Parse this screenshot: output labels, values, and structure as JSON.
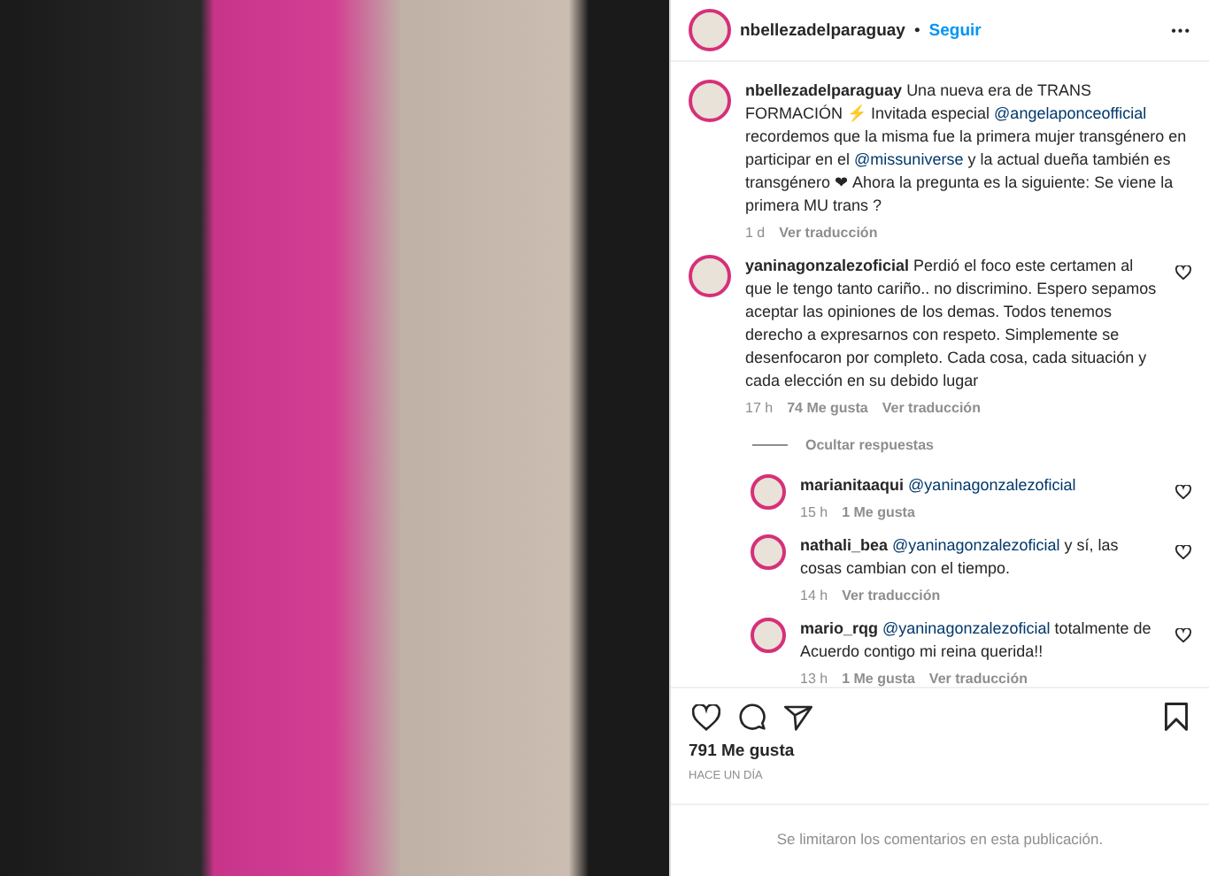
{
  "header": {
    "username": "nbellezadelparaguay",
    "separator": "•",
    "follow": "Seguir",
    "menu": "•••"
  },
  "caption": {
    "username": "nbellezadelparaguay",
    "segments": [
      {
        "kind": "plain",
        "text": "Una nueva era de TRANS FORMACIÓN ⚡ Invitada especial "
      },
      {
        "kind": "mention",
        "text": "@angelaponceofficial"
      },
      {
        "kind": "plain",
        "text": " recordemos que la misma fue la primera mujer transgénero en participar en el "
      },
      {
        "kind": "mention",
        "text": "@missuniverse"
      },
      {
        "kind": "plain",
        "text": " y la actual dueña también es transgénero ❤ Ahora la pregunta es la siguiente: Se viene la primera MU trans ?"
      }
    ],
    "time": "1 d",
    "translate": "Ver traducción"
  },
  "comments": [
    {
      "username": "yaninagonzalezoficial",
      "segments": [
        {
          "kind": "plain",
          "text": "Perdió el foco este certamen al que le tengo tanto cariño.. no discrimino. Espero sepamos aceptar las opiniones de los demas. Todos tenemos derecho a expresarnos con respeto. Simplemente se desenfocaron por completo. Cada cosa, cada situación y cada elección en su debido lugar"
        }
      ],
      "time": "17 h",
      "likes": "74 Me gusta",
      "translate": "Ver traducción",
      "hide_replies": "Ocultar respuestas",
      "replies": [
        {
          "username": "marianitaaqui",
          "segments": [
            {
              "kind": "mention",
              "text": "@yaninagonzalezoficial"
            }
          ],
          "time": "15 h",
          "likes": "1 Me gusta"
        },
        {
          "username": "nathali_bea",
          "segments": [
            {
              "kind": "mention",
              "text": "@yaninagonzalezoficial"
            },
            {
              "kind": "plain",
              "text": " y sí, las cosas cambian con el tiempo."
            }
          ],
          "time": "14 h",
          "translate": "Ver traducción"
        },
        {
          "username": "mario_rqg",
          "segments": [
            {
              "kind": "mention",
              "text": "@yaninagonzalezoficial"
            },
            {
              "kind": "plain",
              "text": " totalmente de Acuerdo contigo mi reina querida!!"
            }
          ],
          "time": "13 h",
          "likes": "1 Me gusta",
          "translate": "Ver traducción"
        }
      ]
    }
  ],
  "likes": "791 Me gusta",
  "posted": "HACE UN DÍA",
  "footer": "Se limitaron los comentarios en esta publicación."
}
